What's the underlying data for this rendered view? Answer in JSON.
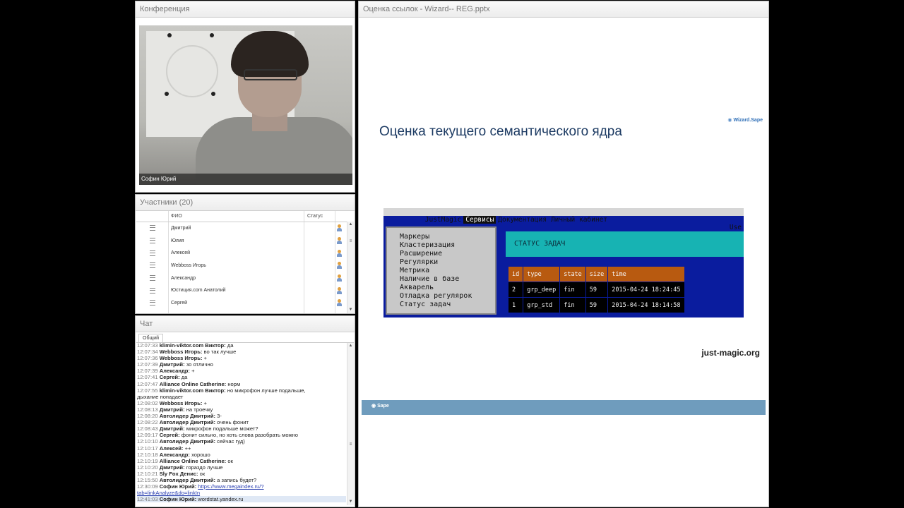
{
  "conference": {
    "title": "Конференция",
    "speaker_label": "Софин Юрий"
  },
  "participants": {
    "title": "Участники (20)",
    "columns": [
      "ФИО",
      "Статус"
    ],
    "rows": [
      "Дмитрий",
      "Юлия",
      "Алексей",
      "Webboss Игорь",
      "Александр",
      "Юстиция.com Анатолий",
      "Сергей"
    ]
  },
  "chat": {
    "title": "Чат",
    "tab": "Общий",
    "messages": [
      {
        "time": "12:07:33",
        "name": "klimin-viktor.com Виктор:",
        "text": "да"
      },
      {
        "time": "12:07:34",
        "name": "Webboss Игорь:",
        "text": "во так лучше"
      },
      {
        "time": "12:07:36",
        "name": "Webboss Игорь:",
        "text": "+"
      },
      {
        "time": "12:07:39",
        "name": "Дмитрий:",
        "text": "зо отлично"
      },
      {
        "time": "12:07:39",
        "name": "Александр:",
        "text": "+"
      },
      {
        "time": "12:07:41",
        "name": "Сергей:",
        "text": "да"
      },
      {
        "time": "12:07:47",
        "name": "Alliance Online Catherine:",
        "text": "норм"
      },
      {
        "time": "12:07:55",
        "name": "klimin-viktor.com Виктор:",
        "text": "но микрофон лучше подальше,"
      },
      {
        "time": "",
        "name": "",
        "text": "дыхание попадает"
      },
      {
        "time": "12:08:02",
        "name": "Webboss Игорь:",
        "text": "+"
      },
      {
        "time": "12:08:13",
        "name": "Дмитрий:",
        "text": "на троечку"
      },
      {
        "time": "12:08:20",
        "name": "Автолидер Дмитрий:",
        "text": "3-"
      },
      {
        "time": "12:08:22",
        "name": "Автолидер Дмитрий:",
        "text": "очень фонит"
      },
      {
        "time": "12:08:43",
        "name": "Дмитрий:",
        "text": "микрофон подальше может?"
      },
      {
        "time": "12:09:17",
        "name": "Сергей:",
        "text": "фонит сильно, но хоть слова разобрать можно"
      },
      {
        "time": "12:10:10",
        "name": "Автолидер Дмитрий:",
        "text": "сейчас гуд)"
      },
      {
        "time": "12:10:17",
        "name": "Алексей:",
        "text": "++"
      },
      {
        "time": "12:10:18",
        "name": "Александр:",
        "text": "хорошо"
      },
      {
        "time": "12:10:19",
        "name": "Alliance Online Catherine:",
        "text": "ок"
      },
      {
        "time": "12:10:20",
        "name": "Дмитрий:",
        "text": "гораздо лучше"
      },
      {
        "time": "12:10:21",
        "name": "Sly Fox Денис:",
        "text": "ок"
      },
      {
        "time": "12:15:50",
        "name": "Автолидер Дмитрий:",
        "text": "а запись будет?"
      },
      {
        "time": "12:30:09",
        "name": "Софин Юрий:",
        "text": "",
        "link": "https://www.megaindex.ru/?"
      },
      {
        "time": "",
        "name": "",
        "text": "",
        "link": "tab=linkAnalyze&do=linkIn"
      },
      {
        "time": "12:41:03",
        "name": "Софин Юрий:",
        "text": "wordstat.yandex.ru"
      }
    ]
  },
  "presentation": {
    "title": "Оценка ссылок - Wizard-- REG.pptx",
    "slide_title": "Оценка текущего семантического ядра",
    "logo": "Wizard.Sape",
    "footer_logo": "Sape",
    "url": "just-magic.org",
    "terminal": {
      "menu": [
        "JustMagic",
        "Сервисы",
        "Документация",
        "Личный кабинет"
      ],
      "menu_active": "Сервисы",
      "menu_user": "Use",
      "sidebar": [
        "Маркеры",
        "Кластеризация",
        "Расширение",
        "Регулярки",
        "Метрика",
        "Наличие в базе",
        "Акварель",
        "Отладка регулярок",
        "Статус задач"
      ],
      "status_title": "СТАТУС ЗАДАЧ",
      "table_header": [
        "id",
        "type",
        "state",
        "size",
        "time"
      ],
      "table_rows": [
        [
          "2",
          "grp_deep",
          "fin",
          "59",
          "2015-04-24 18:24:45"
        ],
        [
          "1",
          "grp_std",
          "fin",
          "59",
          "2015-04-24 18:14:58"
        ]
      ]
    }
  }
}
